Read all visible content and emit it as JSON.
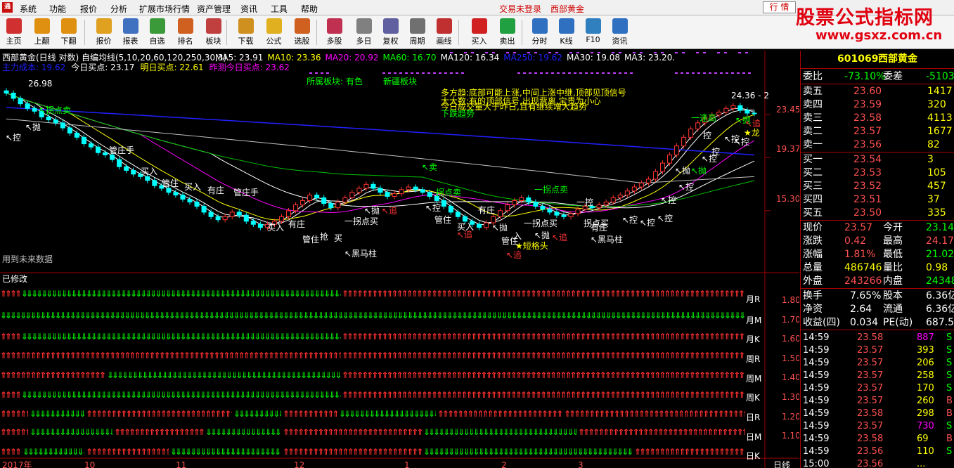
{
  "menubar": {
    "items": [
      "系统",
      "功能",
      "报价",
      "分析",
      "扩展市场行情",
      "资产管理",
      "资讯",
      "工具",
      "帮助"
    ],
    "trade_status": "交易未登录",
    "stock_tab": "西部黄金",
    "quote_tab": "行 情"
  },
  "toolbar": {
    "items": [
      {
        "label": "主页",
        "icon": "home-icon",
        "color": "#d03030"
      },
      {
        "label": "上翻",
        "icon": "arrow-up-icon",
        "color": "#e09010"
      },
      {
        "label": "下翻",
        "icon": "arrow-down-icon",
        "color": "#e09010"
      },
      {
        "label": "报价",
        "icon": "yen-icon",
        "color": "#e0a020"
      },
      {
        "label": "报表",
        "icon": "report-icon",
        "color": "#4070c0"
      },
      {
        "label": "自选",
        "icon": "f6-icon",
        "color": "#3a9a3a"
      },
      {
        "label": "排名",
        "icon": "ranking-icon",
        "color": "#d06020"
      },
      {
        "label": "板块",
        "icon": "sector-icon",
        "color": "#c04040"
      },
      {
        "label": "下载",
        "icon": "download-icon",
        "color": "#d09020"
      },
      {
        "label": "公式",
        "icon": "formula-icon",
        "color": "#e0b020"
      },
      {
        "label": "选股",
        "icon": "stock-pick-icon",
        "color": "#d06020"
      },
      {
        "label": "多股",
        "icon": "multi-stock-icon",
        "color": "#c03050"
      },
      {
        "label": "多日",
        "icon": "clock-icon",
        "color": "#808080"
      },
      {
        "label": "复权",
        "icon": "restore-icon",
        "color": "#6060a0"
      },
      {
        "label": "周期",
        "icon": "f8-icon",
        "color": "#707070"
      },
      {
        "label": "画线",
        "icon": "draw-line-icon",
        "color": "#c03030"
      },
      {
        "label": "买入",
        "icon": "buy-icon",
        "color": "#d02020"
      },
      {
        "label": "卖出",
        "icon": "sell-icon",
        "color": "#20a040"
      },
      {
        "label": "分时",
        "icon": "intraday-icon",
        "color": "#3070c0"
      },
      {
        "label": "K线",
        "icon": "kline-icon",
        "color": "#3070c0"
      },
      {
        "label": "F10",
        "icon": "f10-icon",
        "color": "#3080c0"
      },
      {
        "label": "资讯",
        "icon": "news-icon",
        "color": "#3070c0"
      }
    ]
  },
  "watermark": {
    "text": "股票公式指标网",
    "url": "www.gsxz.com.cn"
  },
  "chart": {
    "title": "西部黄金(日线 对数) 自编均线(5,10,20,60,120,250,30,3)",
    "ma_items": [
      {
        "text": "MA5: 23.91",
        "color": "#ffffff"
      },
      {
        "text": "MA10: 23.36",
        "color": "#ffff00"
      },
      {
        "text": "MA20: 20.92",
        "color": "#ff00ff"
      },
      {
        "text": "MA60: 16.70",
        "color": "#00ff00"
      },
      {
        "text": "MA120: 16.34",
        "color": "#ffffff"
      },
      {
        "text": "MA250: 19.62",
        "color": "#2020ff"
      },
      {
        "text": "MA30: 19.08",
        "color": "#ffffff"
      },
      {
        "text": "MA3: 23.20.",
        "color": "#ffffff"
      }
    ],
    "line2": [
      {
        "text": "主力成本: 19.62",
        "color": "#2020ff"
      },
      {
        "text": "今日买点: 23.17",
        "color": "#ffffff"
      },
      {
        "text": "明日买点: 22.61",
        "color": "#ffff00"
      },
      {
        "text": "昨测今日买点: 23.62",
        "color": "#ff00ff"
      }
    ],
    "sector1": "所属板块: 有色",
    "sector2": "新疆板块",
    "high_label": "26.98",
    "high_label_right": "24.36 - 2",
    "notes": [
      "多方趋:底部可能上涨,中间上涨中继,顶部见顶信号",
      "大大数:有的顶部信号,出现背离,宝贵为小心",
      "今日成交量大于昨日,且有继续增大趋势",
      "下跌趋势"
    ],
    "price_ticks": [
      "23.45",
      "19.37",
      "15.30"
    ],
    "future_note": "用到未来数据",
    "modified_note": "已修改",
    "lower_ticks": [
      "1.80",
      "1.70",
      "1.60",
      "1.50",
      "1.40",
      "1.30",
      "1.20",
      "1.10"
    ],
    "row_labels": [
      "月R",
      "月M",
      "月K",
      "周R",
      "周M",
      "周K",
      "日R",
      "日M",
      "日K"
    ],
    "x_labels": [
      "2017年",
      "10",
      "11",
      "12",
      "1",
      "2",
      "3"
    ],
    "period": "日线"
  },
  "chart_data": {
    "type": "candlestick",
    "title": "西部黄金(日线 对数) 自编均线(5,10,20,60,120,250,30,3)",
    "ylim": [
      13.0,
      27.5
    ],
    "yscale": "log",
    "y_ticks": [
      23.45,
      19.37,
      15.3
    ],
    "x_ticks": [
      "2017年",
      "10",
      "11",
      "12",
      "1",
      "2",
      "3"
    ],
    "annotated_high": 26.98,
    "ma_values": {
      "MA5": 23.91,
      "MA10": 23.36,
      "MA20": 20.92,
      "MA60": 16.7,
      "MA120": 16.34,
      "MA250": 19.62,
      "MA30": 19.08,
      "MA3": 23.2
    },
    "close_series": [
      25.8,
      25.2,
      24.6,
      24.1,
      23.8,
      23.2,
      22.9,
      22.6,
      22.1,
      21.6,
      21.2,
      20.6,
      20.3,
      19.8,
      19.6,
      19.2,
      18.6,
      18.3,
      18.0,
      17.8,
      17.5,
      17.1,
      16.9,
      16.6,
      16.4,
      16.1,
      15.9,
      15.6,
      15.2,
      14.9,
      14.7,
      14.9,
      15.2,
      15.0,
      14.6,
      14.4,
      14.2,
      14.4,
      14.6,
      14.9,
      15.3,
      15.7,
      16.0,
      16.4,
      16.2,
      15.8,
      15.5,
      15.9,
      16.2,
      16.6,
      16.9,
      17.2,
      16.9,
      16.6,
      16.3,
      16.5,
      16.8,
      17.0,
      16.8,
      16.6,
      16.3,
      16.0,
      15.6,
      15.2,
      14.9,
      14.6,
      14.4,
      14.2,
      14.5,
      14.9,
      15.3,
      15.7,
      16.0,
      16.2,
      15.9,
      15.6,
      15.4,
      15.2,
      15.0,
      14.9,
      15.1,
      15.4,
      15.6,
      15.5,
      15.7,
      15.9,
      16.2,
      16.4,
      16.7,
      17.0,
      17.3,
      17.6,
      18.2,
      18.9,
      19.6,
      20.4,
      21.2,
      22.0,
      22.6,
      23.1,
      23.4,
      23.7,
      24.1,
      24.4,
      23.9,
      23.6,
      23.57
    ]
  },
  "right_panel": {
    "code": "601069",
    "name": "西部黄金",
    "webi_label": "委比",
    "webi": "-73.10%",
    "weicha_label": "委差",
    "weicha": "-5103",
    "asks": [
      {
        "label": "卖五",
        "price": "23.60",
        "vol": "1417"
      },
      {
        "label": "卖四",
        "price": "23.59",
        "vol": "320"
      },
      {
        "label": "卖三",
        "price": "23.58",
        "vol": "4113"
      },
      {
        "label": "卖二",
        "price": "23.57",
        "vol": "1677"
      },
      {
        "label": "卖一",
        "price": "23.56",
        "vol": "82"
      }
    ],
    "bids": [
      {
        "label": "买一",
        "price": "23.54",
        "vol": "3"
      },
      {
        "label": "买二",
        "price": "23.53",
        "vol": "105"
      },
      {
        "label": "买三",
        "price": "23.52",
        "vol": "457"
      },
      {
        "label": "买四",
        "price": "23.51",
        "vol": "37"
      },
      {
        "label": "买五",
        "price": "23.50",
        "vol": "335"
      }
    ],
    "stats": [
      {
        "l1": "现价",
        "v1": "23.57",
        "c1": "#ff5050",
        "l2": "今开",
        "v2": "23.14",
        "c2": "#00ff00"
      },
      {
        "l1": "涨跌",
        "v1": "0.42",
        "c1": "#ff5050",
        "l2": "最高",
        "v2": "24.17",
        "c2": "#ff5050"
      },
      {
        "l1": "涨幅",
        "v1": "1.81%",
        "c1": "#ff5050",
        "l2": "最低",
        "v2": "21.02",
        "c2": "#00ff00"
      },
      {
        "l1": "总量",
        "v1": "486746",
        "c1": "#ffff00",
        "l2": "量比",
        "v2": "0.98",
        "c2": "#ffff00"
      },
      {
        "l1": "外盘",
        "v1": "243266",
        "c1": "#ff5050",
        "l2": "内盘",
        "v2": "243480",
        "c2": "#00ff00"
      }
    ],
    "stats2": [
      {
        "l1": "换手",
        "v1": "7.65%",
        "l2": "股本",
        "v2": "6.36亿"
      },
      {
        "l1": "净资",
        "v1": "2.64",
        "l2": "流通",
        "v2": "6.36亿"
      },
      {
        "l1": "收益(四)",
        "v1": "0.034",
        "l2": "PE(动)",
        "v2": "687.5"
      }
    ],
    "ticks": [
      {
        "time": "14:59",
        "price": "23.58",
        "vol": "887",
        "flag": "S",
        "vcolor": "#ff00ff"
      },
      {
        "time": "14:59",
        "price": "23.57",
        "vol": "393",
        "flag": "S",
        "vcolor": "#ffff00"
      },
      {
        "time": "14:59",
        "price": "23.57",
        "vol": "206",
        "flag": "S",
        "vcolor": "#ffff00"
      },
      {
        "time": "14:59",
        "price": "23.57",
        "vol": "258",
        "flag": "S",
        "vcolor": "#ffff00"
      },
      {
        "time": "14:59",
        "price": "23.57",
        "vol": "170",
        "flag": "S",
        "vcolor": "#ffff00"
      },
      {
        "time": "14:59",
        "price": "23.57",
        "vol": "260",
        "flag": "B",
        "vcolor": "#ffff00"
      },
      {
        "time": "14:59",
        "price": "23.58",
        "vol": "298",
        "flag": "B",
        "vcolor": "#ffff00"
      },
      {
        "time": "14:59",
        "price": "23.57",
        "vol": "730",
        "flag": "S",
        "vcolor": "#ff00ff"
      },
      {
        "time": "14:59",
        "price": "23.58",
        "vol": "69",
        "flag": "B",
        "vcolor": "#ffff00"
      },
      {
        "time": "14:59",
        "price": "23.56",
        "vol": "110",
        "flag": "S",
        "vcolor": "#ffff00"
      },
      {
        "time": "15:00",
        "price": "23.56",
        "vol": "...",
        "flag": "",
        "vcolor": "#ffff00"
      }
    ]
  }
}
